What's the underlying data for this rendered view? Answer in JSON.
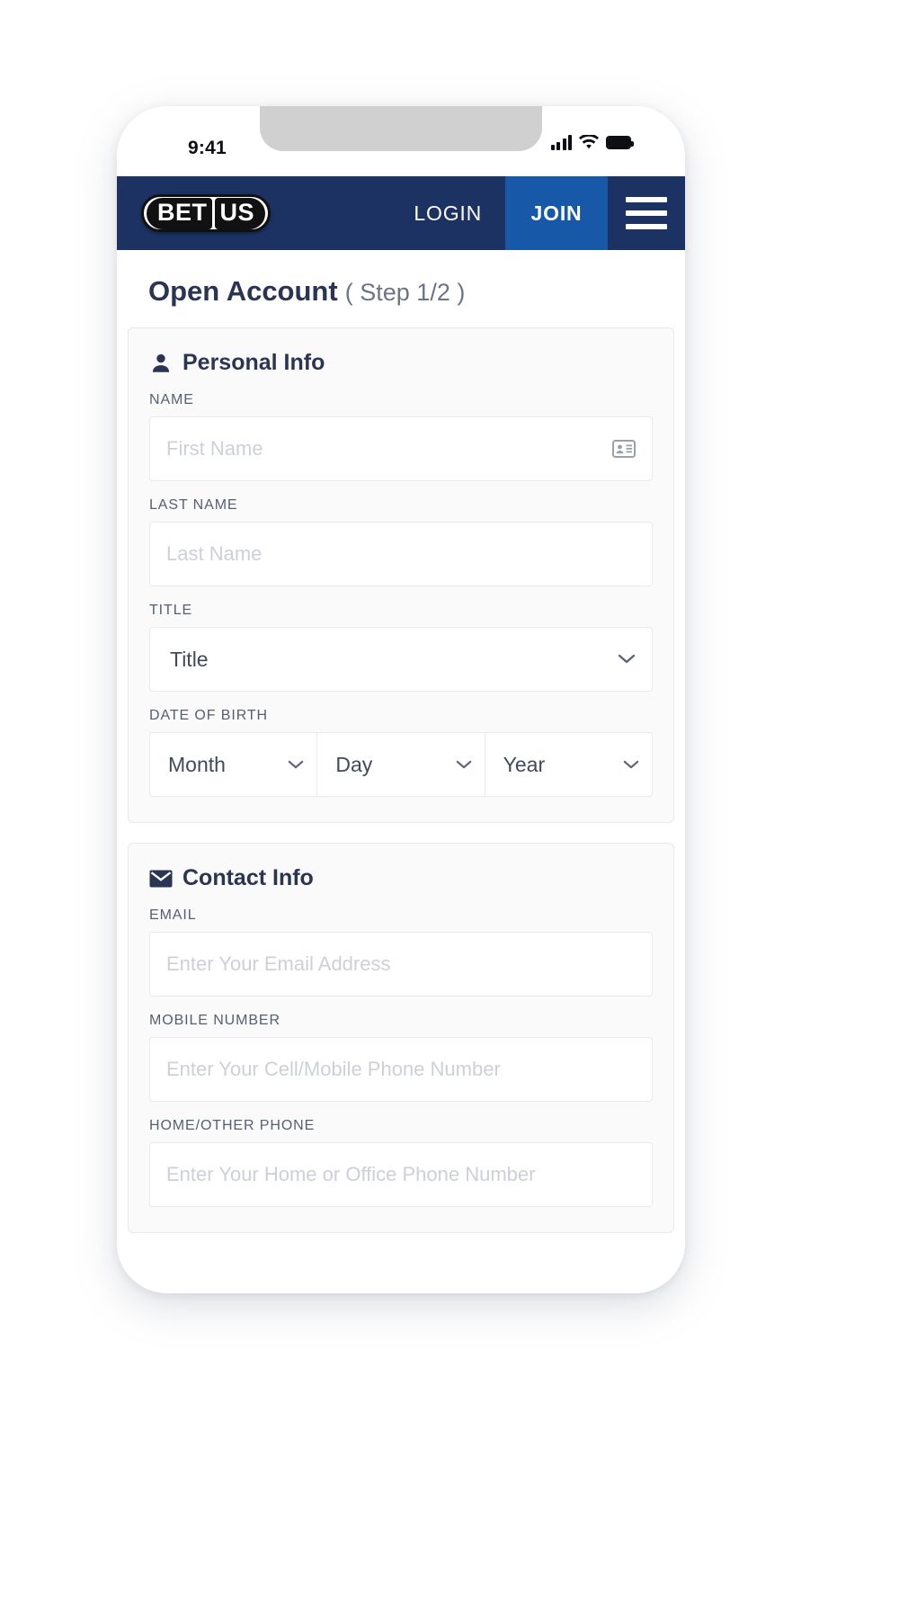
{
  "status_bar": {
    "time": "9:41",
    "icons": [
      "cellular-signal-icon",
      "wifi-icon",
      "battery-icon"
    ]
  },
  "header": {
    "logo_left": "BET",
    "logo_right": "US",
    "login_label": "LOGIN",
    "join_label": "JOIN",
    "menu_icon": "hamburger-menu-icon",
    "colors": {
      "header_bg": "#1b3263",
      "join_bg": "#1759a8"
    }
  },
  "page": {
    "title_main": "Open Account",
    "title_step": "( Step 1/2 )"
  },
  "personal_info": {
    "heading": "Personal Info",
    "heading_icon": "person-icon",
    "fields": {
      "name": {
        "label": "NAME",
        "placeholder": "First Name",
        "value": "",
        "icon": "id-card-icon"
      },
      "last_name": {
        "label": "LAST NAME",
        "placeholder": "Last Name",
        "value": ""
      },
      "title": {
        "label": "TITLE",
        "selected": "Title",
        "icon": "chevron-down-icon"
      },
      "dob": {
        "label": "DATE OF BIRTH",
        "month": "Month",
        "day": "Day",
        "year": "Year"
      }
    }
  },
  "contact_info": {
    "heading": "Contact Info",
    "heading_icon": "envelope-icon",
    "fields": {
      "email": {
        "label": "EMAIL",
        "placeholder": "Enter Your Email Address",
        "value": ""
      },
      "mobile": {
        "label": "MOBILE NUMBER",
        "placeholder": "Enter Your Cell/Mobile Phone Number",
        "value": ""
      },
      "home_phone": {
        "label": "HOME/OTHER PHONE",
        "placeholder": "Enter Your Home or Office Phone Number",
        "value": ""
      }
    }
  }
}
